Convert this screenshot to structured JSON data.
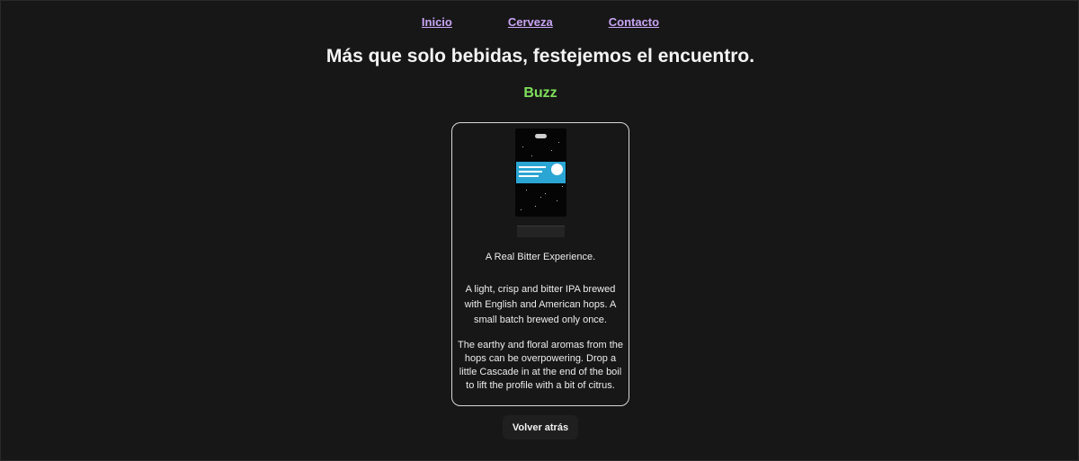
{
  "nav": {
    "items": [
      {
        "label": "Inicio"
      },
      {
        "label": "Cerveza"
      },
      {
        "label": "Contacto"
      }
    ]
  },
  "hero": {
    "title": "Más que solo bebidas, festejemos el encuentro."
  },
  "beer": {
    "name": "Buzz",
    "image_alt": "can-image",
    "tagline": "A Real Bitter Experience.",
    "description": "A light, crisp and bitter IPA brewed with English and American hops. A small batch brewed only once.",
    "brewers_tip": "The earthy and floral aromas from the hops can be overpowering. Drop a little Cascade in at the end of the boil to lift the profile with a bit of citrus."
  },
  "actions": {
    "back_label": "Volver atrás"
  },
  "colors": {
    "background": "#171717",
    "nav_link": "#c9a4f5",
    "beer_name": "#7fe05b",
    "card_border": "#d8d8d8",
    "label_blue": "#2ba6d4"
  }
}
